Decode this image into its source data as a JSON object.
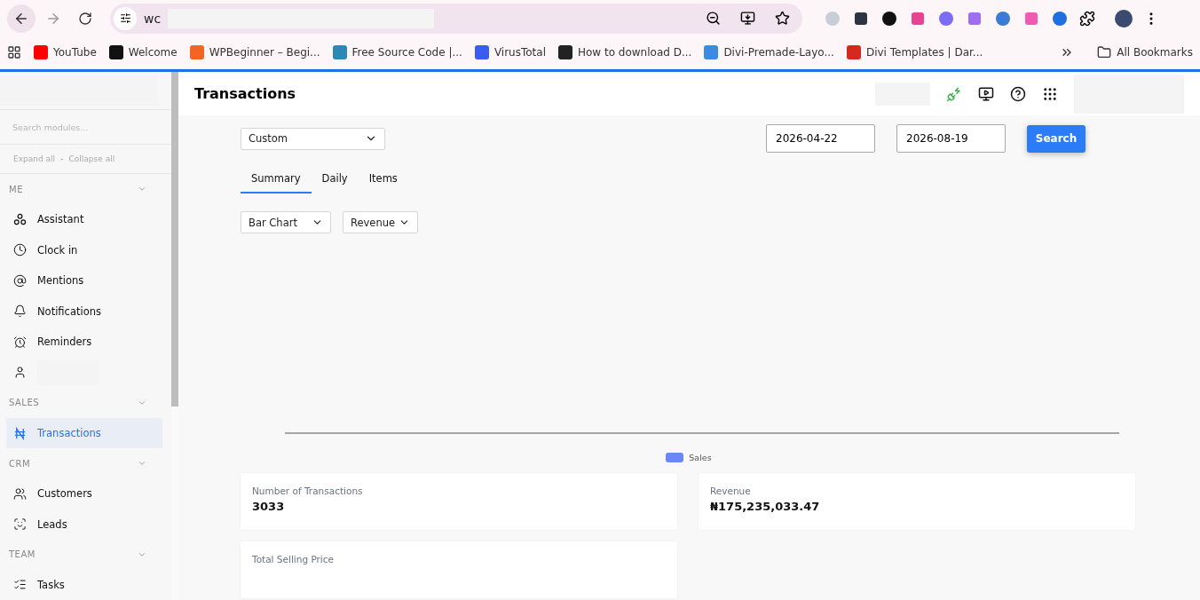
{
  "browser": {
    "address": "wc",
    "bookmarks": [
      {
        "label": "YouTube"
      },
      {
        "label": "Welcome"
      },
      {
        "label": "WPBeginner – Begi..."
      },
      {
        "label": "Free Source Code |..."
      },
      {
        "label": "VirusTotal"
      },
      {
        "label": "How to download D..."
      },
      {
        "label": "Divi-Premade-Layo..."
      },
      {
        "label": "Divi Templates | Dar..."
      }
    ],
    "all_bookmarks": "All Bookmarks"
  },
  "sidebar": {
    "search": {
      "placeholder": "Search modules..."
    },
    "expand_all": "Expand all",
    "separator": "·",
    "collapse_all": "Collapse all",
    "sections": [
      {
        "title": "ME",
        "expanded": true,
        "items": [
          {
            "label": "Assistant",
            "selected": false
          },
          {
            "label": "Clock in",
            "selected": false
          },
          {
            "label": "Mentions",
            "selected": false
          },
          {
            "label": "Notifications",
            "selected": false
          },
          {
            "label": "Reminders",
            "selected": false
          },
          {
            "selected": false
          }
        ]
      },
      {
        "title": "SALES",
        "expanded": true,
        "items": [
          {
            "label": "Transactions",
            "selected": true
          }
        ]
      },
      {
        "title": "CRM",
        "expanded": true,
        "items": [
          {
            "label": "Customers",
            "selected": false
          },
          {
            "label": "Leads",
            "selected": false
          }
        ]
      },
      {
        "title": "TEAM",
        "expanded": true,
        "items": [
          {
            "label": "Tasks",
            "selected": false
          }
        ]
      }
    ]
  },
  "header": {
    "title": "Transactions"
  },
  "filters": {
    "period": "Custom",
    "start_date": "2026-04-22",
    "end_date": "2026-08-19",
    "search_button": "Search"
  },
  "tabs": [
    {
      "label": "Summary",
      "selected": true
    },
    {
      "label": "Daily",
      "selected": false
    },
    {
      "label": "Items",
      "selected": false
    }
  ],
  "chart_options": {
    "chart_type": "Bar Chart",
    "metric": "Revenue"
  },
  "chart": {
    "legend": [
      {
        "name": "Sales",
        "color": "#6b87f7"
      }
    ]
  },
  "cards": [
    {
      "label": "Number of Transactions",
      "value": "3033"
    },
    {
      "label": "Revenue",
      "value": "₦175,235,033.47"
    },
    {
      "label": "Total Selling Price"
    }
  ]
}
